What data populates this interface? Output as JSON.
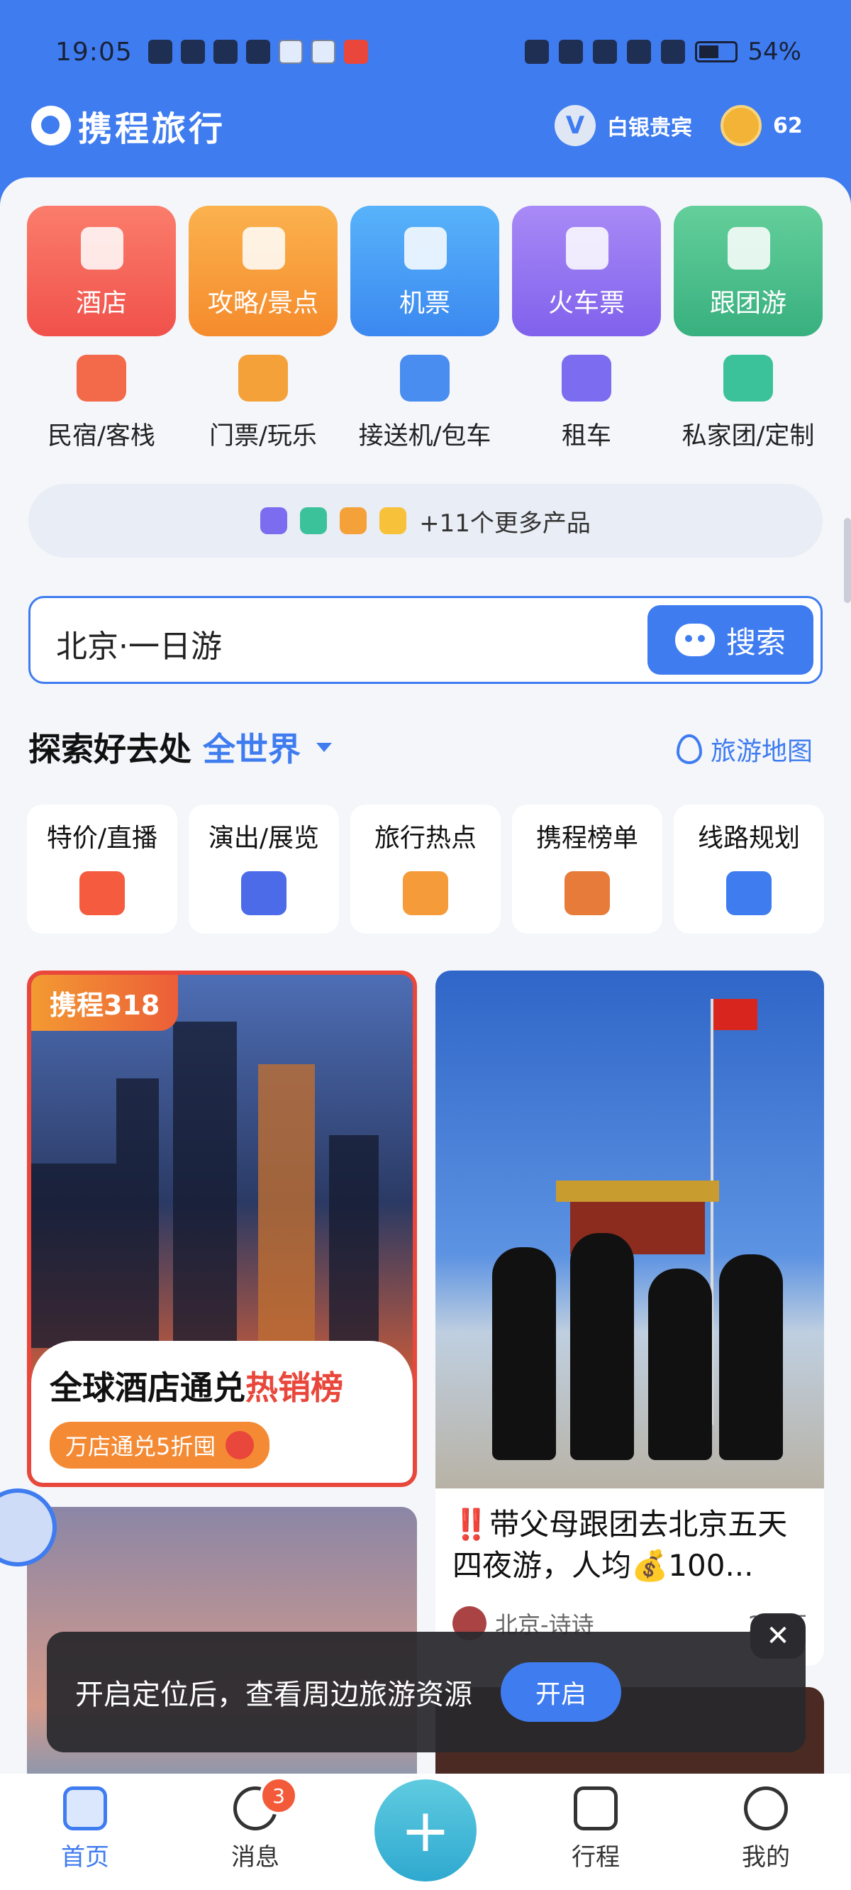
{
  "status": {
    "time": "19:05",
    "battery": "54%"
  },
  "header": {
    "brand": "携程旅行",
    "vip_letter": "V",
    "vip_level": "白银贵宾",
    "points": "62"
  },
  "main_cards": [
    {
      "label": "酒店",
      "color": "#f0514b"
    },
    {
      "label": "攻略/景点",
      "color": "#f58b2c"
    },
    {
      "label": "机票",
      "color": "#3b88f0"
    },
    {
      "label": "火车票",
      "color": "#8061ec"
    },
    {
      "label": "跟团游",
      "color": "#38b07f"
    }
  ],
  "sub_items": [
    {
      "label": "民宿/客栈",
      "color": "#f26a4a"
    },
    {
      "label": "门票/玩乐",
      "color": "#f5a13a"
    },
    {
      "label": "接送机/包车",
      "color": "#4a8df0"
    },
    {
      "label": "租车",
      "color": "#7b6cf0"
    },
    {
      "label": "私家团/定制",
      "color": "#3cc29a"
    }
  ],
  "more_products": "+11个更多产品",
  "search": {
    "value": "北京·一日游",
    "button": "搜索"
  },
  "explore": {
    "title": "探索好去处",
    "scope": "全世界",
    "map_link": "旅游地图"
  },
  "topics": [
    {
      "label": "特价/直播",
      "color": "#f45b3f"
    },
    {
      "label": "演出/展览",
      "color": "#4b6be8"
    },
    {
      "label": "旅行热点",
      "color": "#f59b3a"
    },
    {
      "label": "携程榜单",
      "color": "#e67b3a"
    },
    {
      "label": "线路规划",
      "color": "#3f7cf0"
    }
  ],
  "feed": {
    "left_tag": "携程318",
    "left_title_prefix": "全球酒店通兑",
    "left_title_hot": "热销榜",
    "left_pill": "万店通兑5折囤",
    "right_title_mark": "‼️",
    "right_title": "带父母跟团去北京五天四夜游，人均💰100...",
    "right_author": "北京-诗诗",
    "right_likes": "2.1万"
  },
  "toast": {
    "message": "开启定位后，查看周边旅游资源",
    "button": "开启",
    "close": "✕"
  },
  "tabbar": {
    "home": "首页",
    "messages": "消息",
    "messages_badge": "3",
    "add": "+",
    "trips": "行程",
    "mine": "我的"
  },
  "icons": [
    "search-icon",
    "location-pin-icon",
    "close-icon",
    "home-icon",
    "message-icon",
    "calendar-icon",
    "user-icon",
    "plus-icon"
  ]
}
